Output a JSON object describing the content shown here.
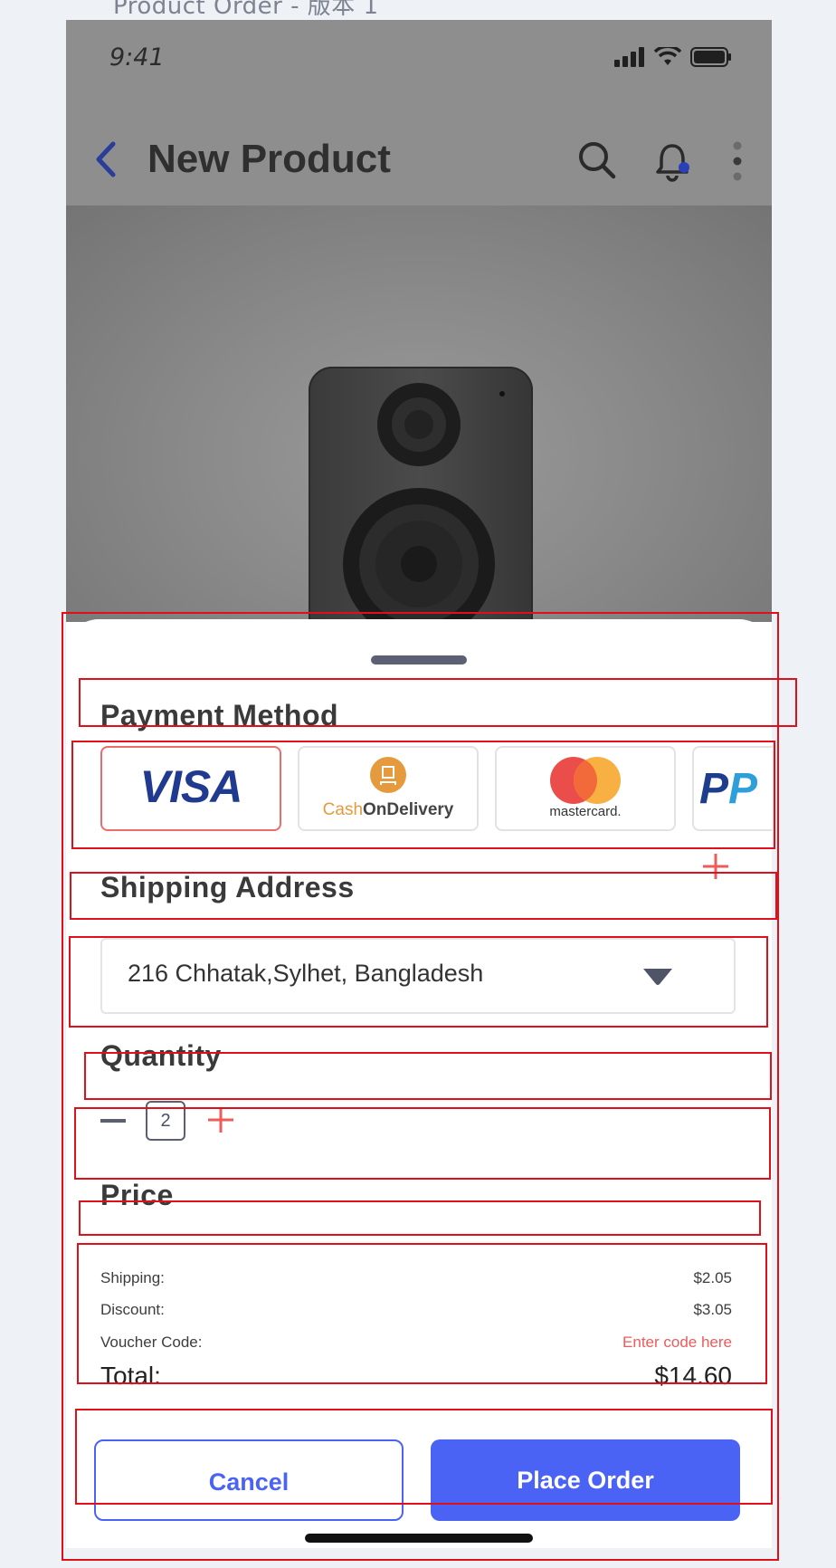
{
  "page_caption": "Product Order - 版本 1",
  "status": {
    "time": "9:41"
  },
  "nav": {
    "title": "New Product"
  },
  "payment": {
    "title": "Payment Method",
    "methods": [
      {
        "name": "VISA",
        "selected": true
      },
      {
        "name": "CashOnDelivery",
        "cash_part": "Cash",
        "rest_part": "OnDelivery",
        "selected": false
      },
      {
        "name": "mastercard.",
        "selected": false
      },
      {
        "name": "PayPal",
        "visible_text": "Pa",
        "selected": false
      }
    ]
  },
  "shipping": {
    "title": "Shipping Address",
    "address": "216 Chhatak,Sylhet, Bangladesh"
  },
  "quantity": {
    "title": "Quantity",
    "value": "2"
  },
  "price": {
    "title": "Price",
    "rows": [
      {
        "label": "Shipping:",
        "value": "$2.05"
      },
      {
        "label": "Discount:",
        "value": "$3.05"
      },
      {
        "label": "Voucher Code:",
        "value": "Enter code here"
      }
    ],
    "total_label": "Total:",
    "total_value": "$14.60"
  },
  "actions": {
    "cancel": "Cancel",
    "place_order": "Place Order"
  },
  "colors": {
    "primary": "#4a63f5",
    "accent_red": "#ef5a5a",
    "annotation_red": "#e0101a"
  }
}
